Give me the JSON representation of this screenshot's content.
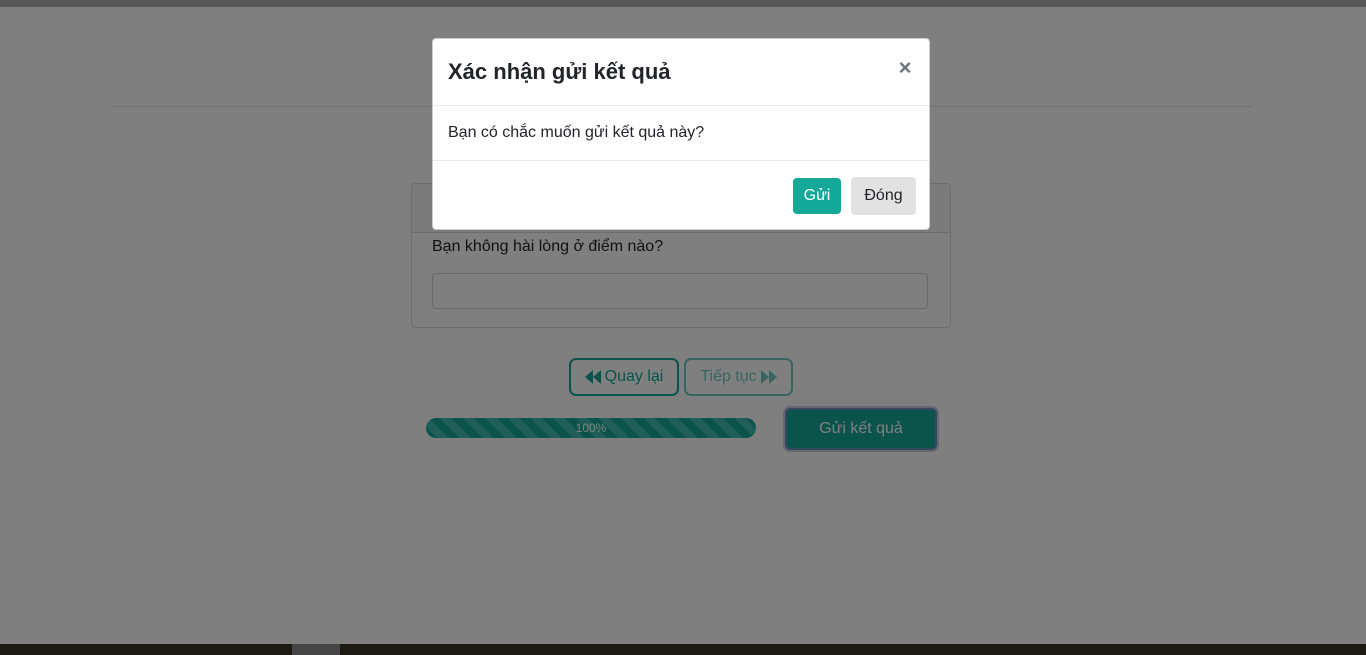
{
  "survey": {
    "question": "Bạn không hài lòng ở điểm nào?",
    "answer_value": "",
    "back_label": "Quay lại",
    "next_label": "Tiếp tục",
    "progress_label": "100%",
    "progress_fraction": 1.0,
    "submit_label": "Gửi kết quả"
  },
  "modal": {
    "title": "Xác nhận gửi kết quả",
    "close_symbol": "×",
    "message": "Bạn có chắc muốn gửi kết quả này?",
    "send_label": "Gửi",
    "close_label": "Đóng"
  },
  "colors": {
    "accent": "#14a899",
    "overlay": "rgba(0,0,0,0.5)",
    "close_button_bg": "#e2e2e2"
  },
  "icons": {
    "back": "double-chevron-left-icon",
    "next": "double-chevron-right-icon",
    "close": "close-icon"
  }
}
